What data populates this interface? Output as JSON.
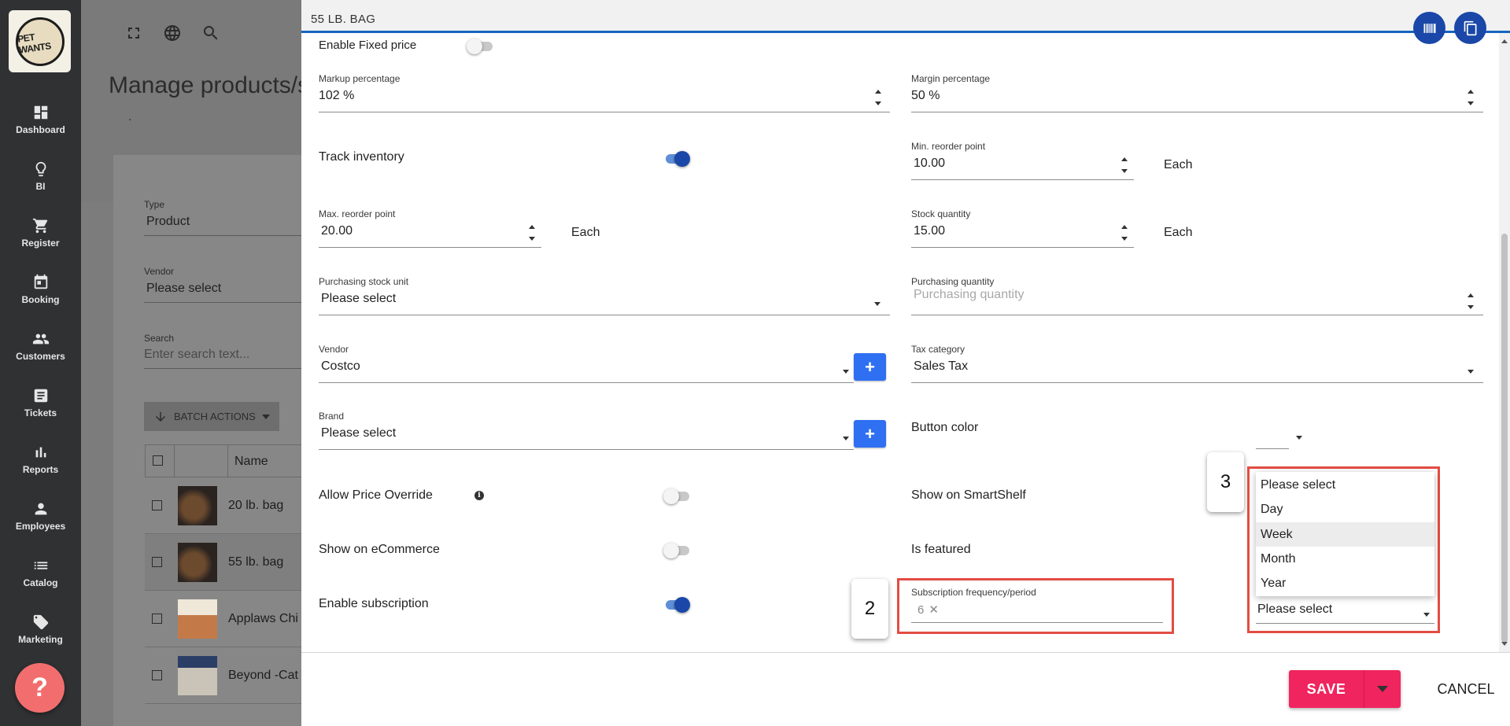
{
  "sidebar": {
    "logo_text": "PET WANTS",
    "items": [
      {
        "label": "Dashboard",
        "icon": "dashboard-icon"
      },
      {
        "label": "BI",
        "icon": "lightbulb-icon"
      },
      {
        "label": "Register",
        "icon": "cart-icon"
      },
      {
        "label": "Booking",
        "icon": "calendar-icon"
      },
      {
        "label": "Customers",
        "icon": "people-icon"
      },
      {
        "label": "Tickets",
        "icon": "ticket-icon"
      },
      {
        "label": "Reports",
        "icon": "bar-chart-icon"
      },
      {
        "label": "Employees",
        "icon": "person-icon"
      },
      {
        "label": "Catalog",
        "icon": "list-icon"
      },
      {
        "label": "Marketing",
        "icon": "tag-icon"
      }
    ],
    "help_label": "?"
  },
  "background": {
    "page_title": "Manage products/s",
    "dot": ".",
    "type_label": "Type",
    "type_value": "Product",
    "vendor_label": "Vendor",
    "vendor_value": "Please select",
    "search_label": "Search",
    "search_placeholder": "Enter search text...",
    "batch_actions": "BATCH ACTIONS",
    "table_header_name": "Name",
    "rows": [
      "20 lb. bag",
      "55 lb. bag",
      "Applaws Chi",
      "Beyond -Cat"
    ]
  },
  "modal": {
    "title": "55 LB. BAG",
    "enable_fixed_price": "Enable Fixed price",
    "markup_label": "Markup percentage",
    "markup_value": "102 %",
    "margin_label": "Margin percentage",
    "margin_value": "50 %",
    "track_inventory": "Track inventory",
    "min_reorder_label": "Min. reorder point",
    "min_reorder_value": "10.00",
    "min_reorder_unit": "Each",
    "max_reorder_label": "Max. reorder point",
    "max_reorder_value": "20.00",
    "max_reorder_unit": "Each",
    "stock_qty_label": "Stock quantity",
    "stock_qty_value": "15.00",
    "stock_qty_unit": "Each",
    "purch_unit_label": "Purchasing stock unit",
    "purch_unit_value": "Please select",
    "purch_qty_label": "Purchasing quantity",
    "purch_qty_placeholder": "Purchasing quantity",
    "vendor_label": "Vendor",
    "vendor_value": "Costco",
    "tax_label": "Tax category",
    "tax_value": "Sales Tax",
    "brand_label": "Brand",
    "brand_value": "Please select",
    "button_color": "Button color",
    "allow_price_override": "Allow Price Override",
    "show_smartshelf": "Show on SmartShelf",
    "show_ecommerce": "Show on eCommerce",
    "is_featured": "Is featured",
    "enable_subscription": "Enable subscription",
    "sub_freq_label": "Subscription frequency/period",
    "sub_freq_value": "6",
    "period_value": "Please select",
    "period_options": [
      "Please select",
      "Day",
      "Week",
      "Month",
      "Year"
    ],
    "callout_2": "2",
    "callout_3": "3",
    "plus": "+",
    "info": "i",
    "clear": "✕",
    "save_label": "SAVE",
    "cancel_label": "CANCEL"
  },
  "colors": {
    "accent": "#1a47a8",
    "save": "#f0245e",
    "annotation": "#e34c43"
  }
}
